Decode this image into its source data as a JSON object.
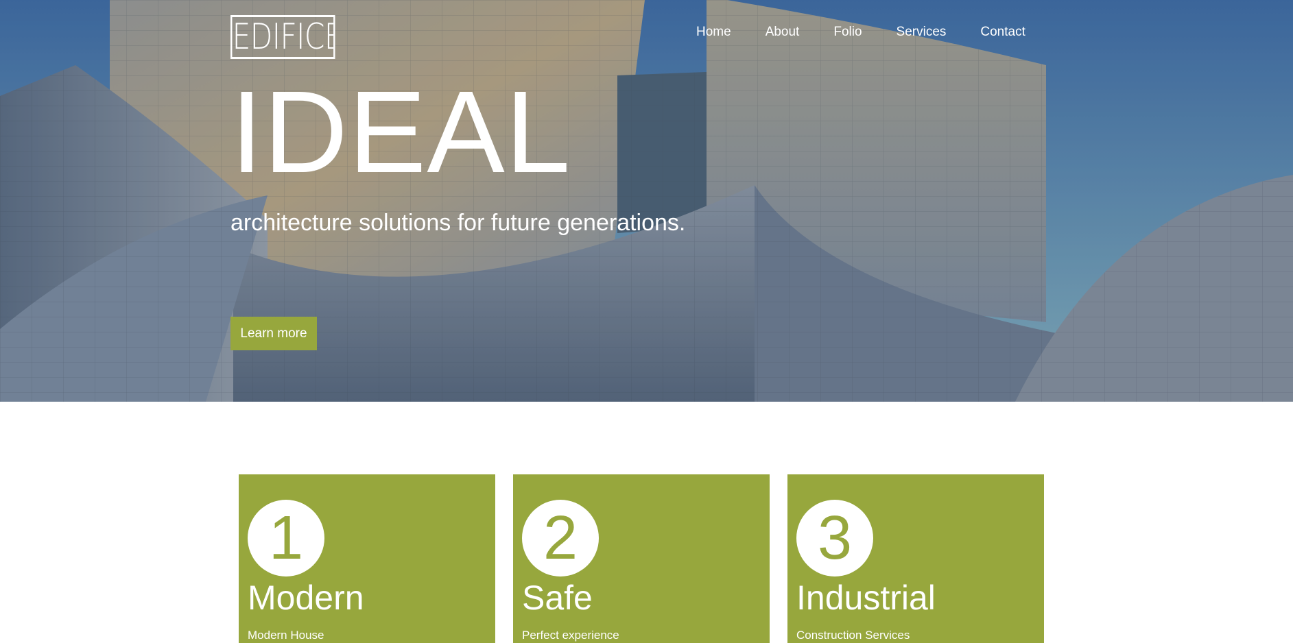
{
  "brand": {
    "logo_text": "EDIFICE",
    "accent_color": "#97a73d"
  },
  "nav": {
    "items": [
      {
        "label": "Home"
      },
      {
        "label": "About"
      },
      {
        "label": "Folio"
      },
      {
        "label": "Services"
      },
      {
        "label": "Contact"
      }
    ]
  },
  "hero": {
    "title": "IDEAL",
    "subtitle": "architecture solutions for future generations.",
    "cta_label": "Learn more"
  },
  "features": [
    {
      "number": "1",
      "title": "Modern",
      "description": "Modern House"
    },
    {
      "number": "2",
      "title": "Safe",
      "description": "Perfect experience"
    },
    {
      "number": "3",
      "title": "Industrial",
      "description": "Construction Services"
    }
  ]
}
